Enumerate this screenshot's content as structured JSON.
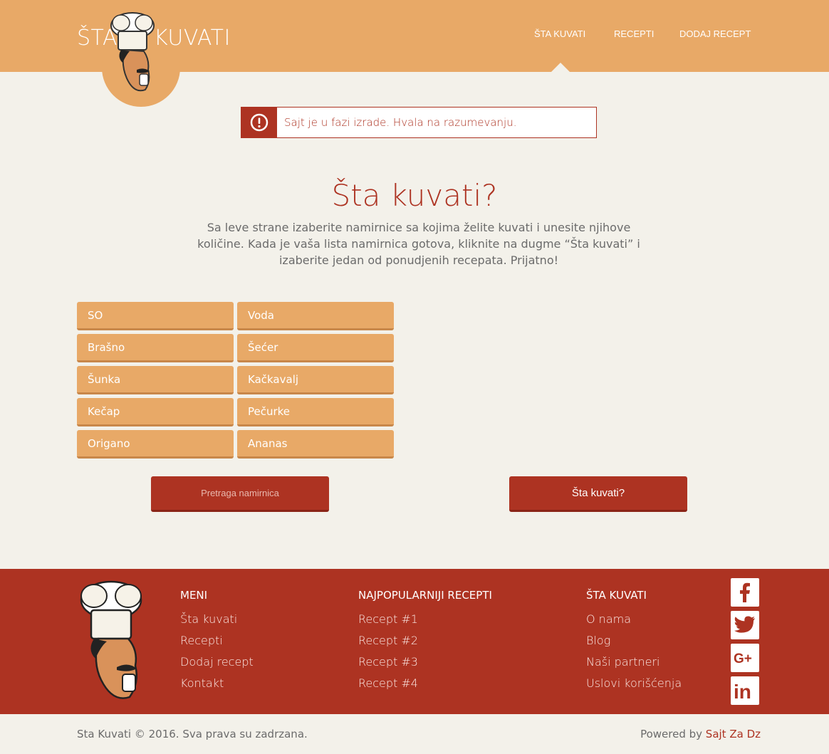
{
  "header": {
    "logo_left": "ŠTA",
    "logo_right": "KUVATI",
    "nav": [
      "ŠTA KUVATI",
      "RECEPTI",
      "DODAJ RECEPT"
    ]
  },
  "alert": {
    "icon": "exclamation-circle-icon",
    "text": "Sajt je u fazi izrade. Hvala na razumevanju."
  },
  "hero": {
    "title": "Šta kuvati?",
    "description": "Sa leve strane izaberite namirnice sa kojima želite kuvati i unesite njihove količine. Kada je vaša lista namirnica gotova, kliknite na dugme “Šta kuvati” i izaberite jedan od ponudjenih recepata. Prijatno!"
  },
  "ingredients": [
    "SO",
    "Voda",
    "Brašno",
    "Šećer",
    "Šunka",
    "Kačkavalj",
    "Kečap",
    "Pečurke",
    "Origano",
    "Ananas"
  ],
  "buttons": {
    "search": "Pretraga namirnica",
    "cook": "Šta kuvati?"
  },
  "footer": {
    "menu": {
      "title": "MENI",
      "items": [
        "Šta kuvati",
        "Recepti",
        "Dodaj recept",
        "Kontakt"
      ]
    },
    "popular": {
      "title": "NAJPOPULARNIJI RECEPTI",
      "items": [
        "Recept #1",
        "Recept #2",
        "Recept #3",
        "Recept #4"
      ]
    },
    "about": {
      "title": "ŠTA KUVATI",
      "items": [
        "O nama",
        "Blog",
        "Naši partneri",
        "Uslovi korišćenja"
      ]
    },
    "social": [
      "facebook-icon",
      "twitter-icon",
      "google-plus-icon",
      "linkedin-icon"
    ]
  },
  "bottom": {
    "copyright": "Sta Kuvati © 2016. Sva prava su zadrzana.",
    "powered_prefix": "Powered by ",
    "powered_link": "Sajt Za Dz"
  },
  "colors": {
    "accent": "#e8a967",
    "brand_red": "#ad3322",
    "background": "#f3f1ea"
  }
}
